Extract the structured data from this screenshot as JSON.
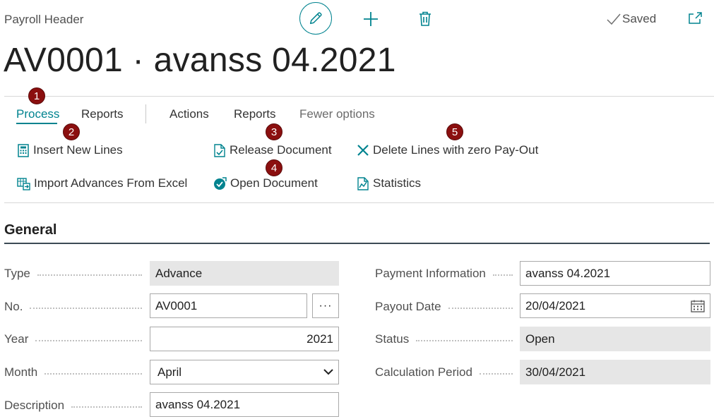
{
  "header": {
    "page_kind": "Payroll Header",
    "saved_label": "Saved",
    "title": "AV0001 · avanss 04.2021",
    "icons": [
      "edit-icon",
      "add-icon",
      "delete-icon",
      "checkmark-icon",
      "open-new-window-icon"
    ]
  },
  "tabs": {
    "process": "Process",
    "reports1": "Reports",
    "actions": "Actions",
    "reports2": "Reports",
    "fewer": "Fewer options"
  },
  "actions": {
    "insert_new_lines": "Insert New Lines",
    "import_advances": "Import Advances From Excel",
    "release_document": "Release Document",
    "open_document": "Open Document",
    "delete_zero": "Delete Lines with zero Pay-Out",
    "statistics": "Statistics"
  },
  "badges": [
    "1",
    "2",
    "3",
    "4",
    "5"
  ],
  "general": {
    "title": "General",
    "type_label": "Type",
    "type_value": "Advance",
    "no_label": "No.",
    "no_value": "AV0001",
    "ellipsis": "···",
    "year_label": "Year",
    "year_value": "2021",
    "month_label": "Month",
    "month_value": "April",
    "description_label": "Description",
    "description_value": "avanss 04.2021",
    "payment_info_label": "Payment Information",
    "payment_info_value": "avanss 04.2021",
    "payout_date_label": "Payout Date",
    "payout_date_value": "20/04/2021",
    "status_label": "Status",
    "status_value": "Open",
    "calc_period_label": "Calculation Period",
    "calc_period_value": "30/04/2021"
  },
  "colors": {
    "accent": "#00838f",
    "badge": "#8b0f0f",
    "readonly_field": "#e6e6e6"
  }
}
